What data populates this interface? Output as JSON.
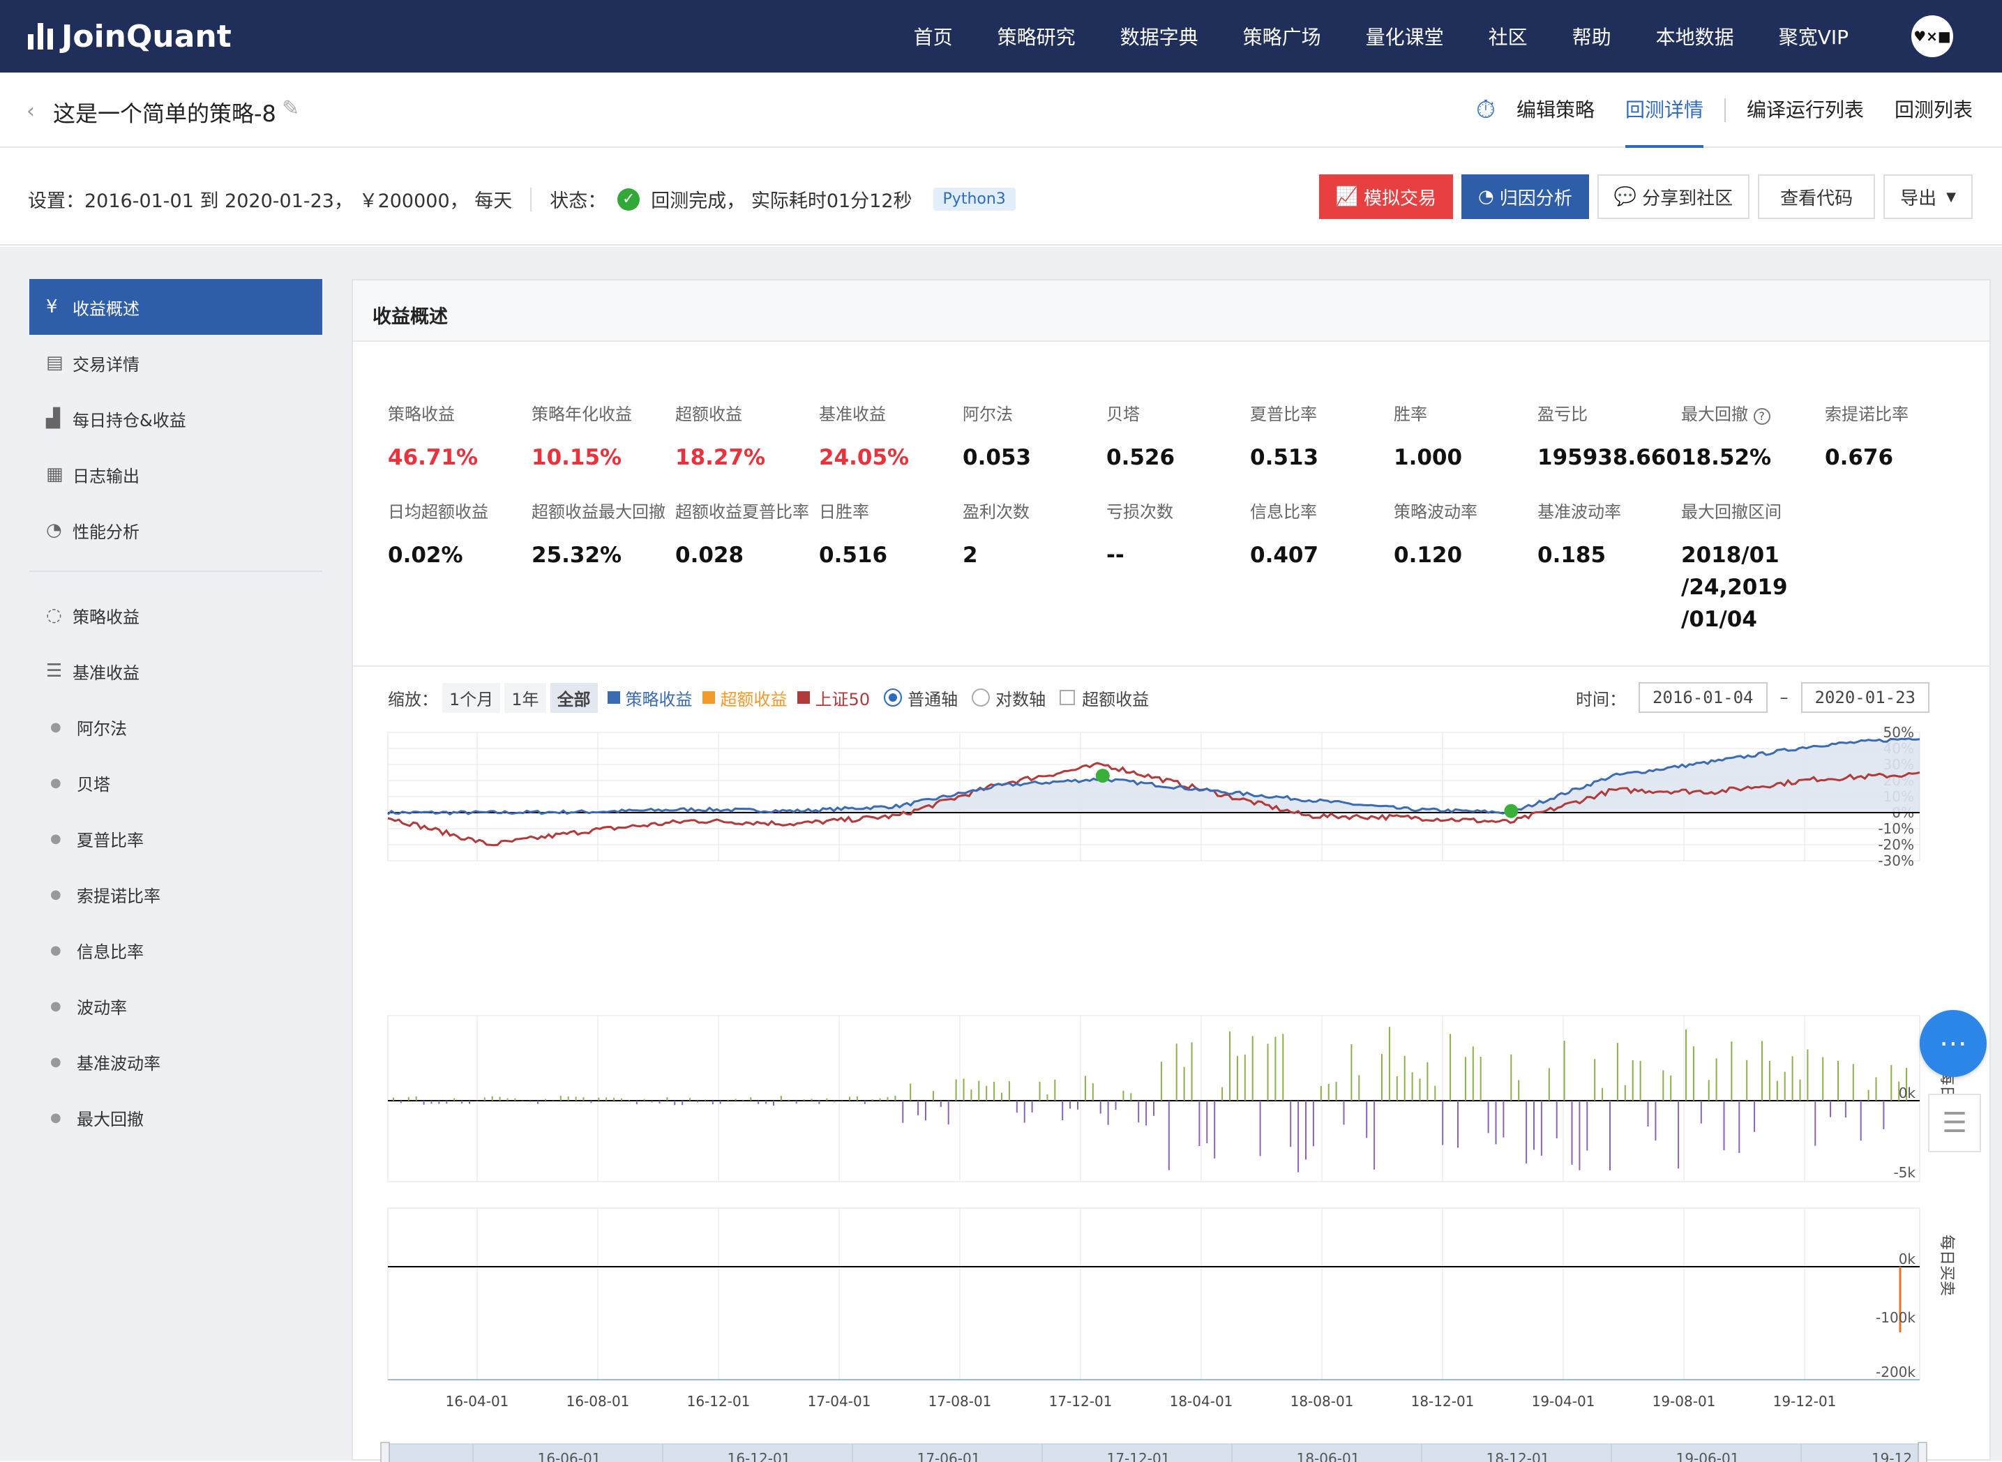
{
  "nav": {
    "brand": "JoinQuant",
    "links": [
      "首页",
      "策略研究",
      "数据字典",
      "策略广场",
      "量化课堂",
      "社区",
      "帮助",
      "本地数据",
      "聚宽VIP"
    ],
    "avatar_text": "♥×■"
  },
  "titlebar": {
    "title": "这是一个简单的策略-8",
    "tabs": [
      "编辑策略",
      "回测详情",
      "编译运行列表",
      "回测列表"
    ],
    "active_tab": "回测详情"
  },
  "info": {
    "settings_label": "设置：",
    "settings_value": "2016-01-01 到 2020-01-23，  ￥200000，  每天",
    "status_label": "状态：",
    "status_value": "回测完成，  实际耗时01分12秒",
    "python_badge": "Python3",
    "buttons": [
      "模拟交易",
      "归因分析",
      "分享到社区",
      "查看代码",
      "导出"
    ]
  },
  "sidebar": {
    "items": [
      {
        "label": "收益概述",
        "icon": "yen-circle-icon",
        "active": true
      },
      {
        "label": "交易详情",
        "icon": "document-icon"
      },
      {
        "label": "每日持仓&收益",
        "icon": "bar-trend-icon"
      },
      {
        "label": "日志输出",
        "icon": "calendar-log-icon"
      },
      {
        "label": "性能分析",
        "icon": "pie-icon"
      },
      {
        "label": "策略收益",
        "icon": "lightbulb-icon"
      },
      {
        "label": "基准收益",
        "icon": "database-icon"
      },
      {
        "label": "阿尔法",
        "icon": "dot"
      },
      {
        "label": "贝塔",
        "icon": "dot"
      },
      {
        "label": "夏普比率",
        "icon": "dot"
      },
      {
        "label": "索提诺比率",
        "icon": "dot"
      },
      {
        "label": "信息比率",
        "icon": "dot"
      },
      {
        "label": "波动率",
        "icon": "dot"
      },
      {
        "label": "基准波动率",
        "icon": "dot"
      },
      {
        "label": "最大回撤",
        "icon": "dot"
      }
    ]
  },
  "panel": {
    "title": "收益概述",
    "metrics_row1": [
      {
        "label": "策略收益",
        "value": "46.71%",
        "red": true
      },
      {
        "label": "策略年化收益",
        "value": "10.15%",
        "red": true
      },
      {
        "label": "超额收益",
        "value": "18.27%",
        "red": true
      },
      {
        "label": "基准收益",
        "value": "24.05%",
        "red": true
      },
      {
        "label": "阿尔法",
        "value": "0.053"
      },
      {
        "label": "贝塔",
        "value": "0.526"
      },
      {
        "label": "夏普比率",
        "value": "0.513"
      },
      {
        "label": "胜率",
        "value": "1.000"
      },
      {
        "label": "盈亏比",
        "value": "195938.660"
      },
      {
        "label": "最大回撤",
        "value": "18.52%",
        "help": true
      },
      {
        "label": "索提诺比率",
        "value": "0.676"
      }
    ],
    "metrics_row2": [
      {
        "label": "日均超额收益",
        "value": "0.02%"
      },
      {
        "label": "超额收益最大回撤",
        "value": "25.32%"
      },
      {
        "label": "超额收益夏普比率",
        "value": "0.028"
      },
      {
        "label": "日胜率",
        "value": "0.516"
      },
      {
        "label": "盈利次数",
        "value": "2"
      },
      {
        "label": "亏损次数",
        "value": "--"
      },
      {
        "label": "信息比率",
        "value": "0.407"
      },
      {
        "label": "策略波动率",
        "value": "0.120"
      },
      {
        "label": "基准波动率",
        "value": "0.185"
      },
      {
        "label": "最大回撤区间",
        "value": "2018/01\n/24,2019\n/01/04"
      }
    ],
    "zoom_label": "缩放：",
    "zoom_buttons": [
      "1个月",
      "1年",
      "全部"
    ],
    "zoom_active": "全部",
    "legend": [
      {
        "name": "策略收益",
        "color": "#3b6bb2"
      },
      {
        "name": "超额收益",
        "color": "#f39a2b"
      },
      {
        "name": "上证50",
        "color": "#b23a3a"
      }
    ],
    "axis_options": [
      "普通轴",
      "对数轴"
    ],
    "axis_selected": "普通轴",
    "excess_checkbox": "超额收益",
    "time_label": "时间：",
    "date_from": "2016-01-04",
    "date_to": "2020-01-23",
    "date_sep": "–"
  },
  "colors": {
    "nav_bg": "#1f2f5a",
    "accent": "#2e5ea9",
    "red": "#e8323c",
    "strategy": "#3b6bb2",
    "benchmark": "#b23a3a",
    "gain_bar": "#8cb04a",
    "loss_bar": "#8a63b8"
  },
  "chart_data": [
    {
      "type": "line",
      "title": "",
      "ylabel": "",
      "ylim": [
        -30,
        50
      ],
      "yticks": [
        "50%",
        "40%",
        "30%",
        "20%",
        "10%",
        "0%",
        "-10%",
        "-20%",
        "-30%"
      ],
      "x": [
        "2016-01",
        "2016-04",
        "2016-08",
        "2016-12",
        "2017-04",
        "2017-08",
        "2017-12",
        "2018-01",
        "2018-04",
        "2018-08",
        "2018-12",
        "2019-01",
        "2019-04",
        "2019-08",
        "2019-12",
        "2020-01"
      ],
      "series": [
        {
          "name": "策略收益",
          "values": [
            0,
            0,
            0.5,
            2,
            1,
            4,
            17,
            21,
            14,
            8,
            2,
            0,
            23,
            32,
            42,
            46.7
          ]
        },
        {
          "name": "上证50",
          "values": [
            -3,
            -20,
            -11,
            -5,
            -7,
            -2,
            18,
            30,
            14,
            -2,
            -3,
            -6,
            14,
            13,
            21,
            24
          ]
        }
      ],
      "markers": [
        {
          "x": "2018-01",
          "y": 23
        },
        {
          "x": "2019-01",
          "y": 1
        }
      ],
      "grid": true
    },
    {
      "type": "bar",
      "title": "",
      "ylabel": "每日盈亏",
      "yticks": [
        "0k",
        "-5k"
      ]
    },
    {
      "type": "bar",
      "title": "",
      "ylabel": "每日买卖",
      "yticks": [
        "0k",
        "-100k",
        "-200k"
      ],
      "xticks": [
        "16-04-01",
        "16-08-01",
        "16-12-01",
        "17-04-01",
        "17-08-01",
        "17-12-01",
        "18-04-01",
        "18-08-01",
        "18-12-01",
        "19-04-01",
        "19-08-01",
        "19-12-01"
      ]
    }
  ],
  "navigator_ticks": [
    "16-06-01",
    "16-12-01",
    "17-06-01",
    "17-12-01",
    "18-06-01",
    "18-12-01",
    "19-06-01",
    "19-12"
  ]
}
